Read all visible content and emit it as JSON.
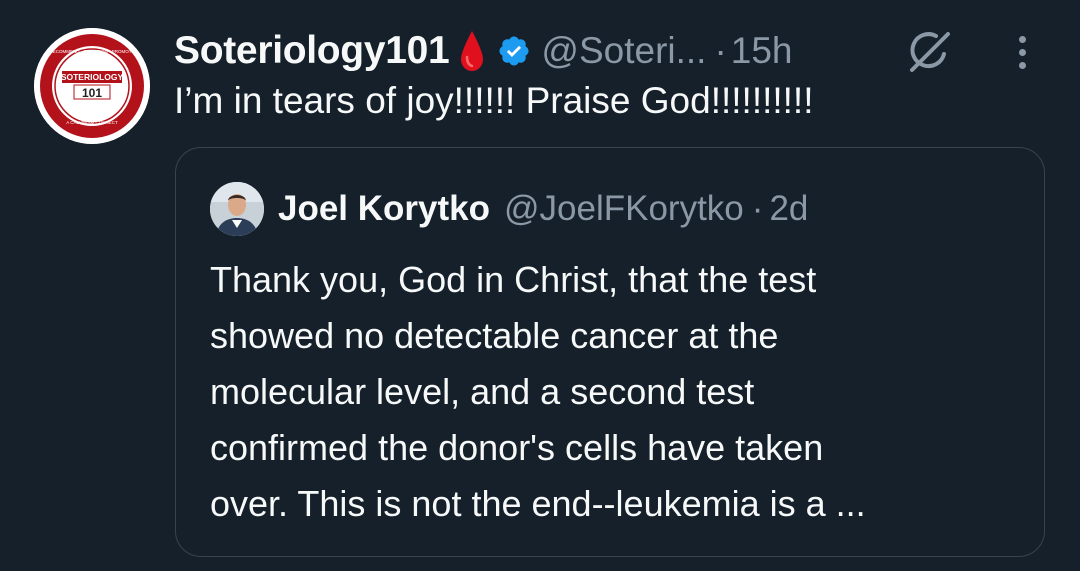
{
  "tweet": {
    "display_name": "Soteriology101",
    "handle": "@Soteri...",
    "separator": "·",
    "time": "15h",
    "text": "I’m in tears of joy!!!!!! Praise God!!!!!!!!!!",
    "avatar": {
      "logo_top": "SOTERIOLOGY",
      "logo_bottom": "101",
      "ring_text_top": "RECOMMEND · SALVATION · PROMOTE",
      "ring_text_bottom": "A CALVINISM CONNECT"
    }
  },
  "quote": {
    "display_name": "Joel Korytko",
    "handle": "@JoelFKorytko",
    "separator": "·",
    "time": "2d",
    "text_lines": [
      "Thank you, God in Christ, that the test",
      "showed no detectable cancer at the",
      "molecular level, and a second test",
      "confirmed the donor's cells have taken",
      "over. This is not the end--leukemia is a ..."
    ]
  },
  "icons": {
    "drop": "blood-drop-icon",
    "verified": "verified-badge-icon",
    "grok": "grok-icon",
    "more": "more-options-icon"
  },
  "colors": {
    "background": "#15202b",
    "text_primary": "#f7f9f9",
    "text_secondary": "#8b98a5",
    "verified": "#1d9bf0",
    "drop": "#e0101f",
    "border": "#38444d"
  }
}
